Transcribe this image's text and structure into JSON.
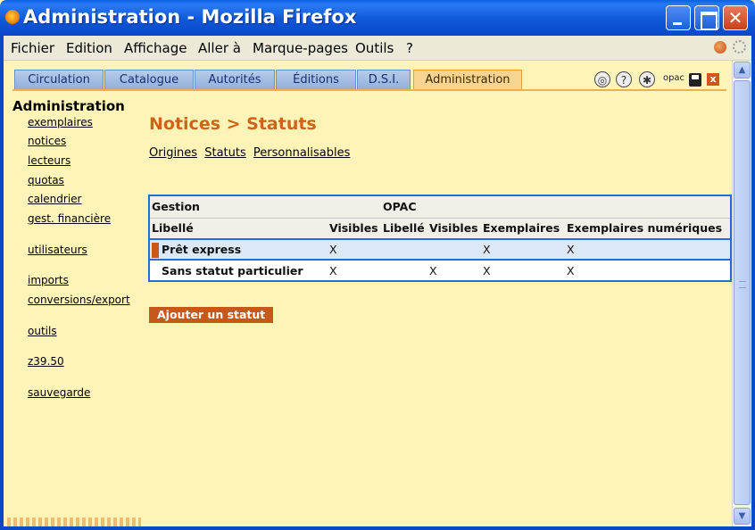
{
  "window": {
    "title": "Administration - Mozilla Firefox",
    "close_glyph": "✕"
  },
  "menubar": {
    "items": [
      {
        "label": "Fichier"
      },
      {
        "label": "Edition"
      },
      {
        "label": "Affichage"
      },
      {
        "label": "Aller à"
      },
      {
        "label": "Marque-pages"
      },
      {
        "label": "Outils"
      },
      {
        "label": "?"
      }
    ]
  },
  "tabs": [
    {
      "label": "Circulation",
      "active": false
    },
    {
      "label": "Catalogue",
      "active": false
    },
    {
      "label": "Autorités",
      "active": false
    },
    {
      "label": "Éditions",
      "active": false
    },
    {
      "label": "D.S.I.",
      "active": false
    },
    {
      "label": "Administration",
      "active": true
    }
  ],
  "toolbar_icons": {
    "opac_label": "opac",
    "close_label": "x",
    "help_label": "?"
  },
  "leftnav": {
    "heading": "Administration",
    "links": [
      {
        "label": "exemplaires"
      },
      {
        "label": "notices"
      },
      {
        "label": "lecteurs"
      },
      {
        "label": "quotas"
      },
      {
        "label": "calendrier"
      },
      {
        "label": "gest. financière"
      },
      {
        "label": "utilisateurs"
      },
      {
        "label": "imports"
      },
      {
        "label": "conversions/export"
      },
      {
        "label": "outils"
      },
      {
        "label": "z39.50"
      },
      {
        "label": "sauvegarde"
      }
    ]
  },
  "main": {
    "page_title": "Notices > Statuts",
    "subnav": [
      "Origines",
      "Statuts",
      "Personnalisables"
    ],
    "table": {
      "group_headers": {
        "gestion": "Gestion",
        "opac": "OPAC"
      },
      "columns": [
        "Libellé",
        "Visibles",
        "Libellé",
        "Visibles",
        "Exemplaires",
        "Exemplaires numériques"
      ],
      "rows": [
        {
          "label": "Prêt express",
          "cells": [
            "X",
            "",
            "",
            "X",
            "X"
          ],
          "selected": true
        },
        {
          "label": "Sans statut particulier",
          "cells": [
            "X",
            "",
            "X",
            "X",
            "X"
          ],
          "selected": false
        }
      ]
    },
    "add_button_label": "Ajouter un statut"
  },
  "colors": {
    "page_background": "#fff4b8",
    "accent_orange": "#cd6418",
    "table_border_blue": "#2a6ad8",
    "titlebar_blue": "#0a48c8"
  }
}
